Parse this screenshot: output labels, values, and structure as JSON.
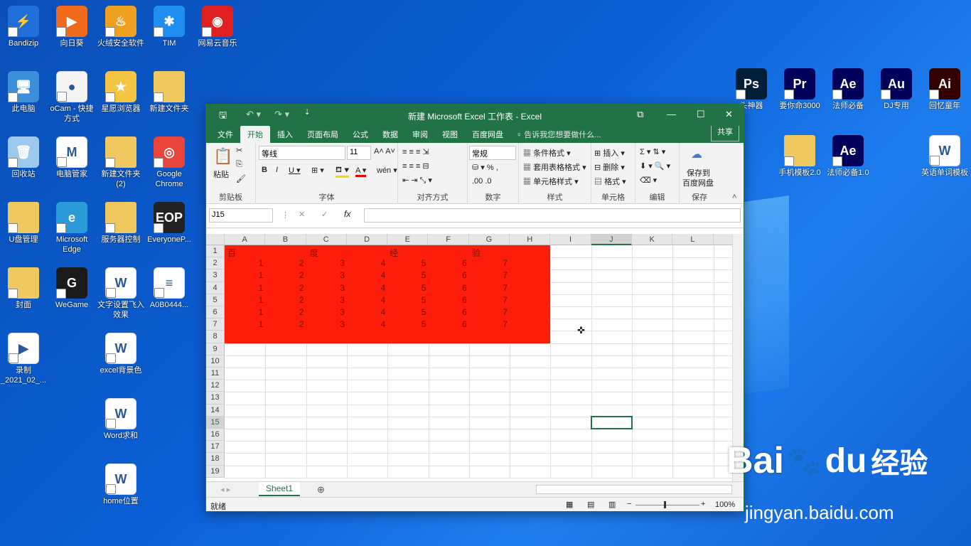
{
  "desktop_icons": [
    {
      "label": "Bandizip",
      "name": "bandizip-icon",
      "color": "#1e6fd9",
      "glyph": "⚡"
    },
    {
      "label": "向日葵",
      "name": "sunflower-icon",
      "color": "#f26a1b",
      "glyph": "▶"
    },
    {
      "label": "火绒安全软件",
      "name": "huorong-icon",
      "color": "#f0a020",
      "glyph": "♨"
    },
    {
      "label": "TIM",
      "name": "tim-icon",
      "color": "#1f8ef1",
      "glyph": "✱"
    },
    {
      "label": "网易云音乐",
      "name": "netease-music-icon",
      "color": "#e02020",
      "glyph": "◉"
    },
    {
      "label": "此电脑",
      "name": "this-pc-icon",
      "color": "#3a8fd8",
      "glyph": "🖥"
    },
    {
      "label": "oCam - 快捷方式",
      "name": "ocam-icon",
      "color": "#f4f4f4",
      "glyph": "●"
    },
    {
      "label": "星愿浏览器",
      "name": "star-browser-icon",
      "color": "#f5c542",
      "glyph": "★"
    },
    {
      "label": "新建文件夹",
      "name": "folder-icon",
      "color": "#f0c860",
      "glyph": ""
    },
    {
      "label": "回收站",
      "name": "recycle-bin-icon",
      "color": "#9cc8ee",
      "glyph": "🗑"
    },
    {
      "label": "电脑管家",
      "name": "pc-manager-icon",
      "color": "#ffffff",
      "glyph": "M"
    },
    {
      "label": "新建文件夹 (2)",
      "name": "folder-icon",
      "color": "#f0c860",
      "glyph": ""
    },
    {
      "label": "Google Chrome",
      "name": "chrome-icon",
      "color": "#e8443a",
      "glyph": "◎"
    },
    {
      "label": "U盘管理",
      "name": "folder-icon",
      "color": "#f0c860",
      "glyph": ""
    },
    {
      "label": "Microsoft Edge",
      "name": "edge-icon",
      "color": "#2a9bd8",
      "glyph": "e"
    },
    {
      "label": "服务器控制",
      "name": "folder-icon",
      "color": "#f0c860",
      "glyph": ""
    },
    {
      "label": "EveryoneP...",
      "name": "eop-icon",
      "color": "#222222",
      "glyph": "EOP"
    },
    {
      "label": "封面",
      "name": "folder-icon",
      "color": "#f0c860",
      "glyph": ""
    },
    {
      "label": "WeGame",
      "name": "wegame-icon",
      "color": "#1a1a1a",
      "glyph": "G"
    },
    {
      "label": "文字设置飞入效果",
      "name": "word-doc-icon",
      "color": "#ffffff",
      "glyph": "W"
    },
    {
      "label": "A0B0444...",
      "name": "doc-icon",
      "color": "#ffffff",
      "glyph": "≡"
    },
    {
      "label": "录制 _2021_02_...",
      "name": "video-icon",
      "color": "#ffffff",
      "glyph": "▶"
    },
    {
      "label": "excel背景色",
      "name": "word-doc-icon",
      "color": "#ffffff",
      "glyph": "W"
    },
    {
      "label": "Word求和",
      "name": "word-doc-icon",
      "color": "#ffffff",
      "glyph": "W"
    },
    {
      "label": "home位置",
      "name": "word-doc-icon",
      "color": "#ffffff",
      "glyph": "W"
    },
    {
      "label": "头神器",
      "name": "photoshop-icon",
      "color": "#001e36",
      "glyph": "Ps"
    },
    {
      "label": "要你命3000",
      "name": "premiere-icon",
      "color": "#00005b",
      "glyph": "Pr"
    },
    {
      "label": "法师必备",
      "name": "after-effects-icon",
      "color": "#00005b",
      "glyph": "Ae"
    },
    {
      "label": "DJ专用",
      "name": "audition-icon",
      "color": "#00005b",
      "glyph": "Au"
    },
    {
      "label": "回忆童年",
      "name": "illustrator-icon",
      "color": "#330000",
      "glyph": "Ai"
    },
    {
      "label": "手机模板2.0",
      "name": "folder-icon",
      "color": "#f0c860",
      "glyph": ""
    },
    {
      "label": "法师必备1.0",
      "name": "after-effects-icon",
      "color": "#00005b",
      "glyph": "Ae"
    },
    {
      "label": "英语单词模板",
      "name": "word-doc-icon",
      "color": "#ffffff",
      "glyph": "W"
    }
  ],
  "window": {
    "title": "新建 Microsoft Excel 工作表 - Excel"
  },
  "tabs": [
    "文件",
    "开始",
    "插入",
    "页面布局",
    "公式",
    "数据",
    "审阅",
    "视图",
    "百度网盘"
  ],
  "tell_me": "♀ 告诉我您想要做什么...",
  "share": "共享",
  "ribbon": {
    "paste": "粘贴",
    "clipboard": "剪贴板",
    "font_name": "等线",
    "font_size": "11",
    "font": "字体",
    "align": "对齐方式",
    "number_format": "常规",
    "number": "数字",
    "cond_fmt": "条件格式 ▾",
    "table_fmt": "套用表格格式 ▾",
    "cell_style": "单元格样式 ▾",
    "styles": "样式",
    "insert": "插入 ▾",
    "delete": "删除 ▾",
    "format": "格式 ▾",
    "cells": "单元格",
    "edit": "编辑",
    "save_to": "保存到",
    "baidu_disk": "百度网盘",
    "save": "保存"
  },
  "formula_bar": {
    "name_box": "J15",
    "fx": "fx",
    "value": ""
  },
  "columns": [
    "A",
    "B",
    "C",
    "D",
    "E",
    "F",
    "G",
    "H",
    "I",
    "J",
    "K",
    "L"
  ],
  "rows": [
    "1",
    "2",
    "3",
    "4",
    "5",
    "6",
    "7",
    "8",
    "9",
    "10",
    "11",
    "12",
    "13",
    "14",
    "15",
    "16",
    "17",
    "18",
    "19"
  ],
  "row1": [
    "百",
    "度",
    "经",
    "验"
  ],
  "data_rows": [
    [
      "1",
      "2",
      "3",
      "4",
      "5",
      "6",
      "7"
    ],
    [
      "1",
      "2",
      "3",
      "4",
      "5",
      "6",
      "7"
    ],
    [
      "1",
      "2",
      "3",
      "4",
      "5",
      "6",
      "7"
    ],
    [
      "1",
      "2",
      "3",
      "4",
      "5",
      "6",
      "7"
    ],
    [
      "1",
      "2",
      "3",
      "4",
      "5",
      "6",
      "7"
    ],
    [
      "1",
      "2",
      "3",
      "4",
      "5",
      "6",
      "7"
    ]
  ],
  "fill_color": "#fe1c0a",
  "sheet_tab": "Sheet1",
  "status": {
    "ready": "就绪",
    "zoom": "100%"
  },
  "watermark": {
    "brand": "Bai",
    "brand2": "du",
    "text": "经验",
    "url": "jingyan.baidu.com"
  }
}
